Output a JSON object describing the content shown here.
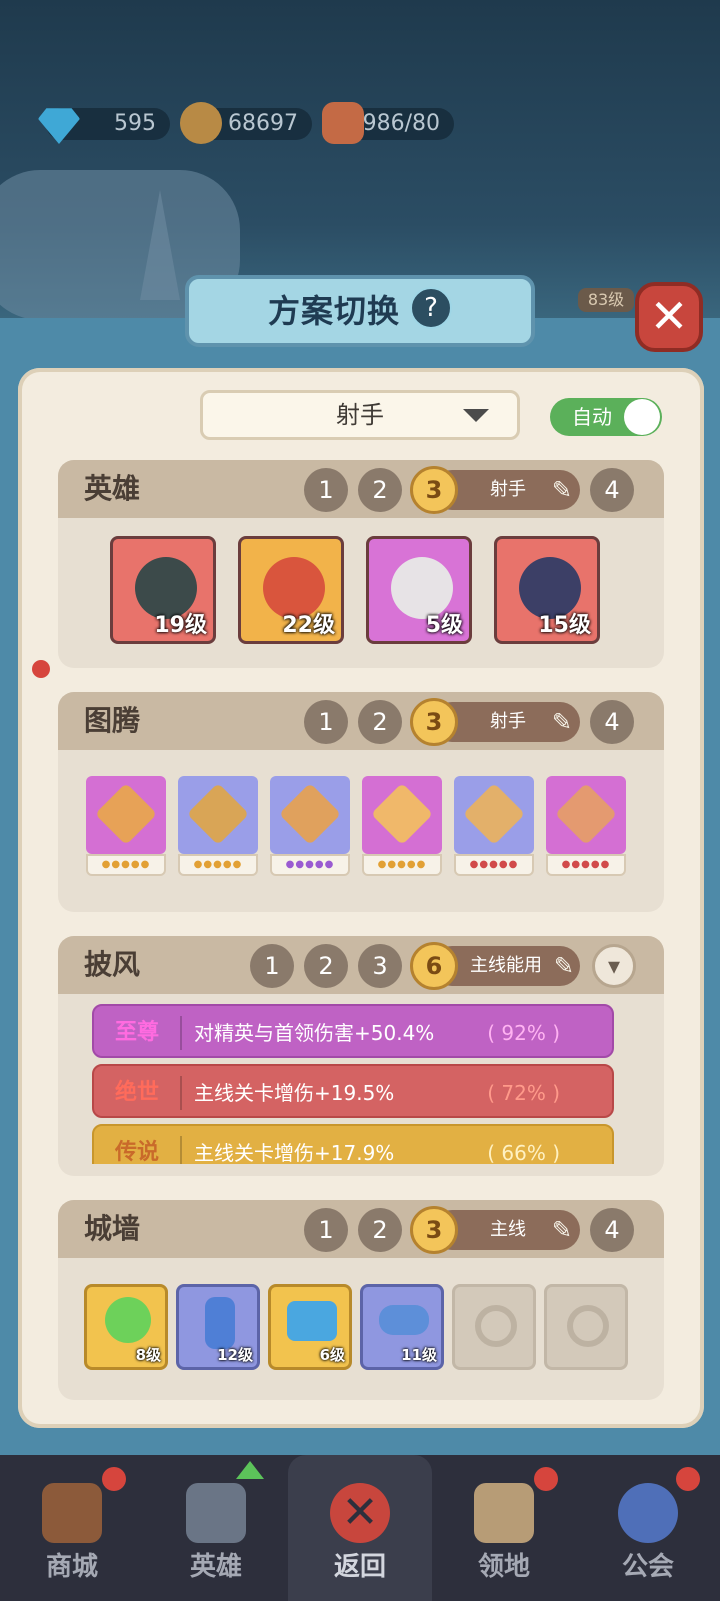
{
  "resources": {
    "gems": "595",
    "coins": "68697",
    "stamina": "986/80"
  },
  "background": {
    "level_badge": "83级"
  },
  "dialog": {
    "title": "方案切换",
    "help": "?",
    "close": "✕"
  },
  "preset": {
    "selected": "射手",
    "auto_label": "自动",
    "auto_on": true
  },
  "heroes": {
    "title": "英雄",
    "slots": [
      "1",
      "2",
      "3",
      "4"
    ],
    "active_slot": "3",
    "active_label": "射手",
    "cards": [
      {
        "level": "19级",
        "color": "#e8736b"
      },
      {
        "level": "22级",
        "color": "#f2b34a"
      },
      {
        "level": "5级",
        "color": "#d873d6"
      },
      {
        "level": "15级",
        "color": "#e8736b"
      }
    ]
  },
  "totems": {
    "title": "图腾",
    "slots": [
      "1",
      "2",
      "3",
      "4"
    ],
    "active_slot": "3",
    "active_label": "射手",
    "cards": [
      {
        "color": "#d46fd3",
        "gem": "#e7a257"
      },
      {
        "color": "#9a9ee8",
        "gem": "#d9a556"
      },
      {
        "color": "#9a9ee8",
        "gem": "#e0a15d"
      },
      {
        "color": "#d46fd3",
        "gem": "#f0b86a"
      },
      {
        "color": "#9a9ee8",
        "gem": "#e3b06a"
      },
      {
        "color": "#d46fd3",
        "gem": "#e49a70"
      }
    ]
  },
  "cloak": {
    "title": "披风",
    "slots": [
      "1",
      "2",
      "3"
    ],
    "active_slot": "6",
    "active_label": "主线能用",
    "expand_icon": "▾",
    "rows": [
      {
        "tag": "至尊",
        "text": "对精英与首领伤害+50.4%",
        "pct": "( 92% )",
        "bg": "#bf62c4",
        "tag_color": "#f0d"
      },
      {
        "tag": "绝世",
        "text": "主线关卡增伤+19.5%",
        "pct": "( 72% )",
        "bg": "#d46363",
        "tag_color": "#ff6b5b"
      },
      {
        "tag": "传说",
        "text": "主线关卡增伤+17.9%",
        "pct": "( 66% )",
        "bg": "#e2b043",
        "tag_color": "#c96a2a"
      }
    ]
  },
  "wall": {
    "title": "城墙",
    "slots": [
      "1",
      "2",
      "3",
      "4"
    ],
    "active_slot": "3",
    "active_label": "主线",
    "cards": [
      {
        "level": "8级",
        "color": "#f2c34e"
      },
      {
        "level": "12级",
        "color": "#8f97e0"
      },
      {
        "level": "6级",
        "color": "#f2c34e"
      },
      {
        "level": "11级",
        "color": "#8f97e0"
      }
    ]
  },
  "nav": {
    "items": [
      {
        "label": "商城",
        "badge": true
      },
      {
        "label": "英雄",
        "badge": false
      },
      {
        "label": "返回",
        "badge": false
      },
      {
        "label": "领地",
        "badge": true
      },
      {
        "label": "公会",
        "badge": true
      }
    ]
  }
}
